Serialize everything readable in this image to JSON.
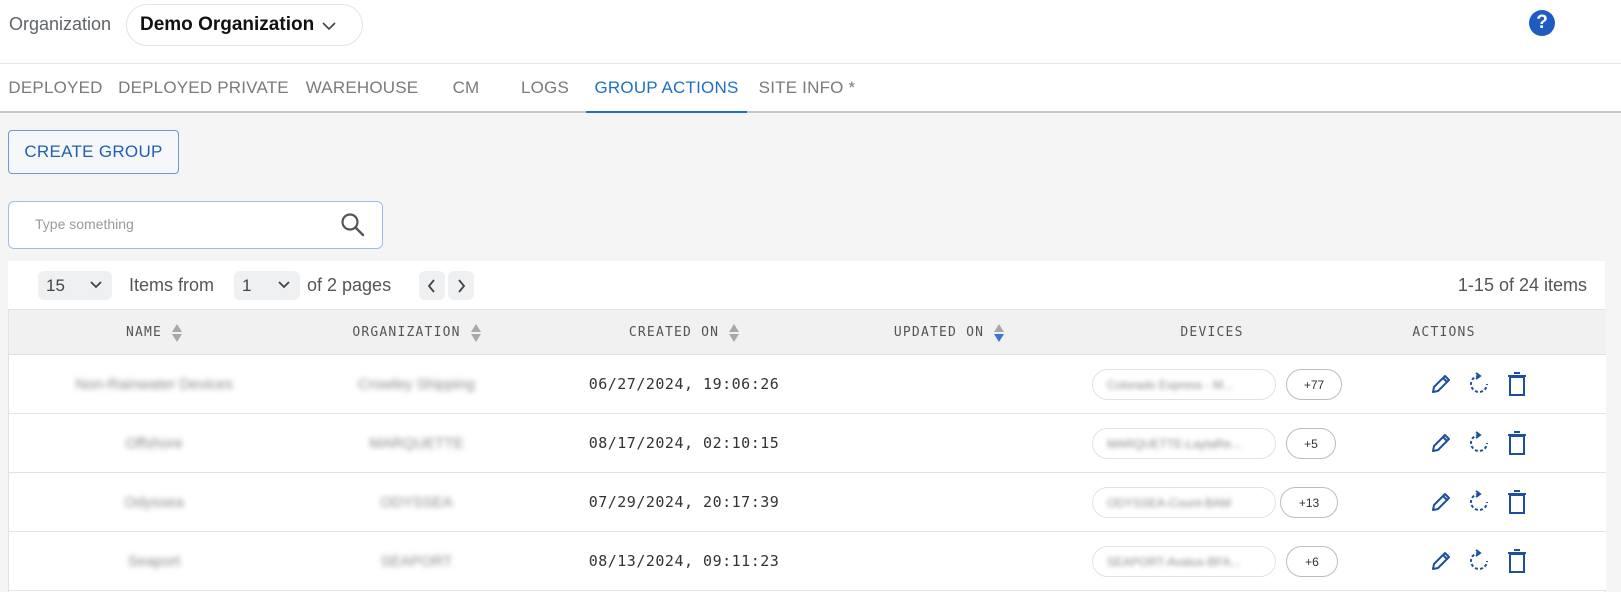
{
  "header": {
    "org_label": "Organization",
    "org_value": "Demo Organization",
    "help_label": "?"
  },
  "tabs": [
    {
      "label": "DEPLOYED",
      "active": false
    },
    {
      "label": "DEPLOYED PRIVATE",
      "active": false
    },
    {
      "label": "WAREHOUSE",
      "active": false
    },
    {
      "label": "CM",
      "active": false
    },
    {
      "label": "LOGS",
      "active": false
    },
    {
      "label": "GROUP ACTIONS",
      "active": true
    },
    {
      "label": "SITE INFO *",
      "active": false
    }
  ],
  "toolbar": {
    "create_label": "CREATE GROUP"
  },
  "search": {
    "placeholder": "Type something",
    "value": ""
  },
  "pager": {
    "page_size": "15",
    "items_from_label": "Items from",
    "page": "1",
    "of_pages_label": "of 2 pages",
    "items_count": "1-15 of 24 items"
  },
  "table": {
    "columns": {
      "name": "NAME",
      "organization": "ORGANIZATION",
      "created_on": "CREATED ON",
      "updated_on": "UPDATED ON",
      "devices": "DEVICES",
      "actions": "ACTIONS"
    },
    "rows": [
      {
        "name": "Non-Rainwater Devices",
        "organization": "Crowley Shipping",
        "created_on": "06/27/2024, 19:06:26",
        "updated_on": "",
        "device": "Colorado Express - M...",
        "more": "+77"
      },
      {
        "name": "Offshore",
        "organization": "MARQUETTE",
        "created_on": "08/17/2024, 02:10:15",
        "updated_on": "",
        "device": "MARQUETTE-LaytaRe...",
        "more": "+5"
      },
      {
        "name": "Odyssea",
        "organization": "ODYSSEA",
        "created_on": "07/29/2024, 20:17:39",
        "updated_on": "",
        "device": "ODYSSEA-Count-BAM",
        "more": "+13"
      },
      {
        "name": "Seaport",
        "organization": "SEAPORT",
        "created_on": "08/13/2024, 09:11:23",
        "updated_on": "",
        "device": "SEAPORT-Avatus-BFA...",
        "more": "+6"
      }
    ]
  },
  "colors": {
    "accent": "#1f6fc4",
    "help": "#1f5cbf",
    "action_icon": "#1f4f9c"
  },
  "icons": [
    "chevron-down-icon",
    "help-icon",
    "search-icon",
    "chevron-left-icon",
    "chevron-right-icon",
    "edit-icon",
    "refresh-icon",
    "delete-icon",
    "sort-icon"
  ]
}
